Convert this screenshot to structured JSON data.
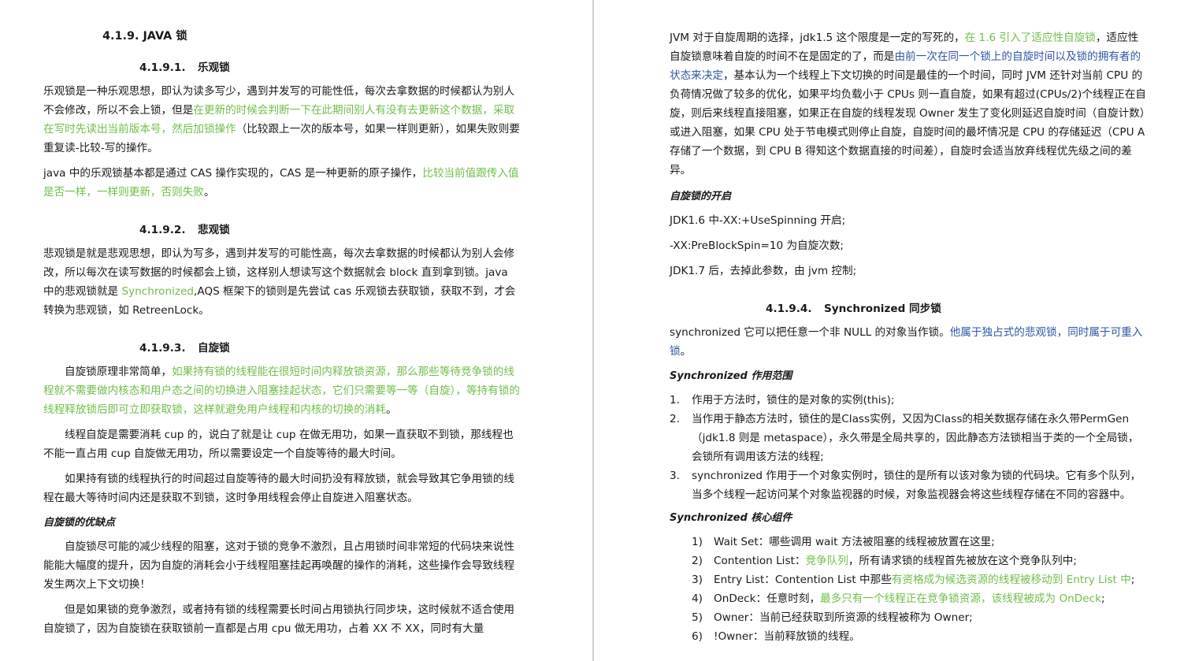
{
  "left": {
    "h_java_lock": "4.1.9.  JAVA 锁",
    "optimistic": {
      "num": "4.1.9.1.",
      "title": "乐观锁",
      "p1_a": "乐观锁是一种乐观思想，即认为读多写少，遇到并发写的可能性低，每次去拿数据的时候都认为别人不会修改，所以不会上锁，但是",
      "p1_g": "在更新的时候会判断一下在此期间别人有没有去更新这个数据，采取在写时先读出当前版本号，然后加锁操作",
      "p1_b": "（比较跟上一次的版本号，如果一样则更新），如果失败则要重复读-比较-写的操作。",
      "p2_a": "java 中的乐观锁基本都是通过 CAS 操作实现的，CAS 是一种更新的原子操作，",
      "p2_g": "比较当前值跟传入值是否一样，一样则更新，否则失败",
      "p2_c": "。"
    },
    "pessimistic": {
      "num": "4.1.9.2.",
      "title": "悲观锁",
      "p1_a": "悲观锁是就是悲观思想，即认为写多，遇到并发写的可能性高，每次去拿数据的时候都认为别人会修改，所以每次在读写数据的时候都会上锁，这样别人想读写这个数据就会 block 直到拿到锁。java 中的悲观锁就是 ",
      "p1_g": "Synchronized",
      "p1_b": ",AQS 框架下的锁则是先尝试 cas 乐观锁去获取锁，获取不到，才会转换为悲观锁，如 RetreenLock。"
    },
    "spin": {
      "num": "4.1.9.3.",
      "title": "自旋锁",
      "p1_a": "自旋锁原理非常简单，",
      "p1_g": "如果持有锁的线程能在很短时间内释放锁资源，那么那些等待竞争锁的线程就不需要做内核态和用户态之间的切换进入阻塞挂起状态，它们只需要等一等（自旋），等持有锁的线程释放锁后即可立即获取锁，这样就避免用户线程和内核的切换的消耗",
      "p1_c": "。",
      "p2": "线程自旋是需要消耗 cup 的，说白了就是让 cup 在做无用功，如果一直获取不到锁，那线程也不能一直占用 cup 自旋做无用功，所以需要设定一个自旋等待的最大时间。",
      "p3": "如果持有锁的线程执行的时间超过自旋等待的最大时间扔没有释放锁，就会导致其它争用锁的线程在最大等待时间内还是获取不到锁，这时争用线程会停止自旋进入阻塞状态。",
      "pros_title": "自旋锁的优缺点",
      "p4": "自旋锁尽可能的减少线程的阻塞，这对于锁的竞争不激烈，且占用锁时间非常短的代码块来说性能能大幅度的提升，因为自旋的消耗会小于线程阻塞挂起再唤醒的操作的消耗，这些操作会导致线程发生两次上下文切换！",
      "p5": "但是如果锁的竞争激烈，或者持有锁的线程需要长时间占用锁执行同步块，这时候就不适合使用自旋锁了，因为自旋锁在获取锁前一直都是占用 cpu 做无用功，占着 XX 不 XX，同时有大量"
    }
  },
  "right": {
    "p1_a": "JVM 对于自旋周期的选择，jdk1.5 这个限度是一定的写死的，",
    "p1_g": "在 1.6 引入了适应性自旋锁",
    "p1_b": "，适应性自旋锁意味着自旋的时间不在是固定的了，而是",
    "p1_blue": "由前一次在同一个锁上的自旋时间以及锁的拥有者的状态来决定",
    "p1_c": "，基本认为一个线程上下文切换的时间是最佳的一个时间，同时 JVM 还针对当前 CPU 的负荷情况做了较多的优化，如果平均负载小于 CPUs 则一直自旋，如果有超过(CPUs/2)个线程正在自旋，则后来线程直接阻塞，如果正在自旋的线程发现 Owner 发生了变化则延迟自旋时间（自旋计数）或进入阻塞，如果 CPU 处于节电模式则停止自旋，自旋时间的最坏情况是 CPU 的存储延迟（CPU A 存储了一个数据，到 CPU B 得知这个数据直接的时间差），自旋时会适当放弃线程优先级之间的差异。",
    "enable_title": "自旋锁的开启",
    "enable_1": "JDK1.6 中-XX:+UseSpinning 开启;",
    "enable_2": "-XX:PreBlockSpin=10 为自旋次数;",
    "enable_3": "JDK1.7 后，去掉此参数，由 jvm 控制;",
    "sync": {
      "num": "4.1.9.4.",
      "title": "Synchronized 同步锁",
      "p1_a": "synchronized 它可以把任意一个非 NULL 的对象当作锁。",
      "p1_blue": "他属于独占式的悲观锁，同时属于可重入锁",
      "p1_c": "。",
      "scope_title": "Synchronized 作用范围",
      "scope": [
        {
          "n": "1.",
          "text": "作用于方法时，锁住的是对象的实例(this);"
        },
        {
          "n": "2.",
          "text": "当作用于静态方法时，锁住的是Class实例，又因为Class的相关数据存储在永久带PermGen（jdk1.8 则是 metaspace），永久带是全局共享的，因此静态方法锁相当于类的一个全局锁，会锁所有调用该方法的线程;"
        },
        {
          "n": "3.",
          "text": "synchronized 作用于一个对象实例时，锁住的是所有以该对象为锁的代码块。它有多个队列，当多个线程一起访问某个对象监视器的时候，对象监视器会将这些线程存储在不同的容器中。"
        }
      ],
      "core_title": "Synchronized 核心组件",
      "core": [
        {
          "n": "1)",
          "a": "Wait Set：哪些调用 wait 方法被阻塞的线程被放置在这里;",
          "g": "",
          "c": ""
        },
        {
          "n": "2)",
          "a": "Contention List：",
          "g": "竞争队列",
          "c": "，所有请求锁的线程首先被放在这个竞争队列中;"
        },
        {
          "n": "3)",
          "a": "Entry List：Contention List 中那些",
          "g": "有资格成为候选资源的线程被移动到 Entry List 中",
          "c": ";"
        },
        {
          "n": "4)",
          "a": "OnDeck：任意时刻，",
          "g": "最多只有一个线程正在竞争锁资源，该线程被成为 OnDeck",
          "c": ";"
        },
        {
          "n": "5)",
          "a": "Owner：当前已经获取到所资源的线程被称为 Owner;",
          "g": "",
          "c": ""
        },
        {
          "n": "6)",
          "a": "!Owner：当前释放锁的线程。",
          "g": "",
          "c": ""
        }
      ]
    }
  },
  "colors": {
    "green": "#6fbf4a",
    "blue": "#2f55a4",
    "text": "#1a1a1a"
  }
}
